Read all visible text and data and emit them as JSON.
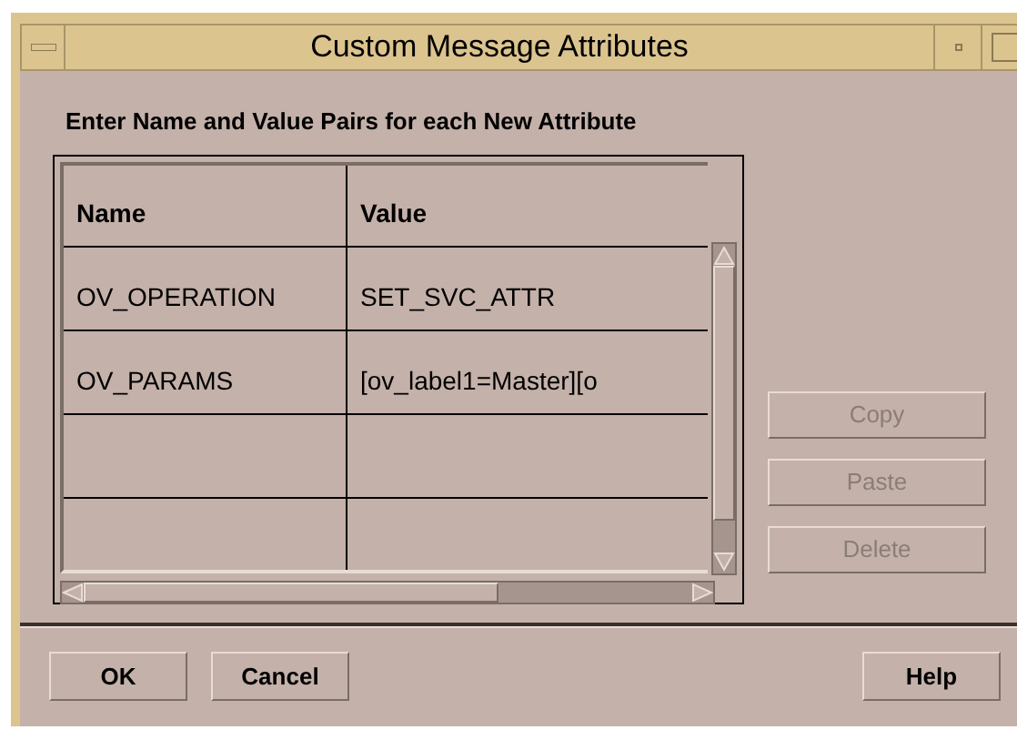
{
  "window": {
    "title": "Custom Message Attributes"
  },
  "instruction": "Enter Name and Value Pairs for each New Attribute",
  "table": {
    "columns": [
      "Name",
      "Value"
    ],
    "rows": [
      {
        "name": "OV_OPERATION",
        "value": "SET_SVC_ATTR"
      },
      {
        "name": "OV_PARAMS",
        "value": "[ov_label1=Master][o"
      }
    ]
  },
  "side_buttons": [
    {
      "label": "Copy",
      "disabled": true
    },
    {
      "label": "Paste",
      "disabled": true
    },
    {
      "label": "Delete",
      "disabled": true
    }
  ],
  "buttons": [
    {
      "label": "OK"
    },
    {
      "label": "Cancel"
    },
    {
      "label": "Help"
    }
  ]
}
